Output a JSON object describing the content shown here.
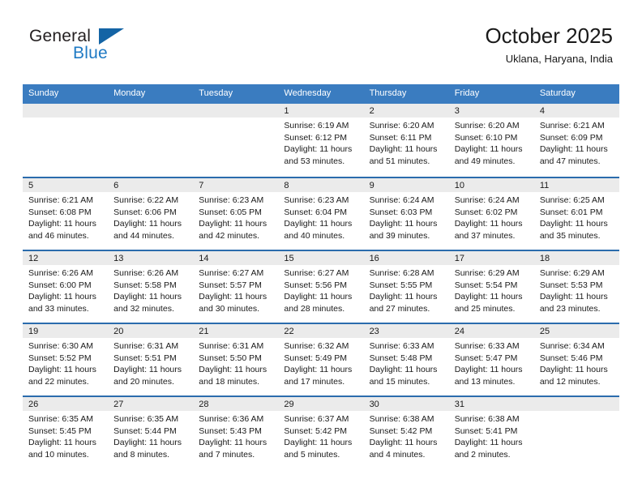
{
  "brand": {
    "name_top": "General",
    "name_bottom": "Blue",
    "triangle_icon": "triangle-icon",
    "accent_color": "#1f7ac4",
    "dark_color": "#231f20"
  },
  "header": {
    "title": "October 2025",
    "subtitle": "Uklana, Haryana, India"
  },
  "calendar": {
    "header_bg": "#3a7cc0",
    "row_divider": "#2b6cad",
    "day_band_bg": "#ebebeb",
    "weekdays": [
      "Sunday",
      "Monday",
      "Tuesday",
      "Wednesday",
      "Thursday",
      "Friday",
      "Saturday"
    ],
    "weeks": [
      [
        {
          "day": "",
          "sunrise": "",
          "sunset": "",
          "daylight_line1": "",
          "daylight_line2": ""
        },
        {
          "day": "",
          "sunrise": "",
          "sunset": "",
          "daylight_line1": "",
          "daylight_line2": ""
        },
        {
          "day": "",
          "sunrise": "",
          "sunset": "",
          "daylight_line1": "",
          "daylight_line2": ""
        },
        {
          "day": "1",
          "sunrise": "Sunrise: 6:19 AM",
          "sunset": "Sunset: 6:12 PM",
          "daylight_line1": "Daylight: 11 hours",
          "daylight_line2": "and 53 minutes."
        },
        {
          "day": "2",
          "sunrise": "Sunrise: 6:20 AM",
          "sunset": "Sunset: 6:11 PM",
          "daylight_line1": "Daylight: 11 hours",
          "daylight_line2": "and 51 minutes."
        },
        {
          "day": "3",
          "sunrise": "Sunrise: 6:20 AM",
          "sunset": "Sunset: 6:10 PM",
          "daylight_line1": "Daylight: 11 hours",
          "daylight_line2": "and 49 minutes."
        },
        {
          "day": "4",
          "sunrise": "Sunrise: 6:21 AM",
          "sunset": "Sunset: 6:09 PM",
          "daylight_line1": "Daylight: 11 hours",
          "daylight_line2": "and 47 minutes."
        }
      ],
      [
        {
          "day": "5",
          "sunrise": "Sunrise: 6:21 AM",
          "sunset": "Sunset: 6:08 PM",
          "daylight_line1": "Daylight: 11 hours",
          "daylight_line2": "and 46 minutes."
        },
        {
          "day": "6",
          "sunrise": "Sunrise: 6:22 AM",
          "sunset": "Sunset: 6:06 PM",
          "daylight_line1": "Daylight: 11 hours",
          "daylight_line2": "and 44 minutes."
        },
        {
          "day": "7",
          "sunrise": "Sunrise: 6:23 AM",
          "sunset": "Sunset: 6:05 PM",
          "daylight_line1": "Daylight: 11 hours",
          "daylight_line2": "and 42 minutes."
        },
        {
          "day": "8",
          "sunrise": "Sunrise: 6:23 AM",
          "sunset": "Sunset: 6:04 PM",
          "daylight_line1": "Daylight: 11 hours",
          "daylight_line2": "and 40 minutes."
        },
        {
          "day": "9",
          "sunrise": "Sunrise: 6:24 AM",
          "sunset": "Sunset: 6:03 PM",
          "daylight_line1": "Daylight: 11 hours",
          "daylight_line2": "and 39 minutes."
        },
        {
          "day": "10",
          "sunrise": "Sunrise: 6:24 AM",
          "sunset": "Sunset: 6:02 PM",
          "daylight_line1": "Daylight: 11 hours",
          "daylight_line2": "and 37 minutes."
        },
        {
          "day": "11",
          "sunrise": "Sunrise: 6:25 AM",
          "sunset": "Sunset: 6:01 PM",
          "daylight_line1": "Daylight: 11 hours",
          "daylight_line2": "and 35 minutes."
        }
      ],
      [
        {
          "day": "12",
          "sunrise": "Sunrise: 6:26 AM",
          "sunset": "Sunset: 6:00 PM",
          "daylight_line1": "Daylight: 11 hours",
          "daylight_line2": "and 33 minutes."
        },
        {
          "day": "13",
          "sunrise": "Sunrise: 6:26 AM",
          "sunset": "Sunset: 5:58 PM",
          "daylight_line1": "Daylight: 11 hours",
          "daylight_line2": "and 32 minutes."
        },
        {
          "day": "14",
          "sunrise": "Sunrise: 6:27 AM",
          "sunset": "Sunset: 5:57 PM",
          "daylight_line1": "Daylight: 11 hours",
          "daylight_line2": "and 30 minutes."
        },
        {
          "day": "15",
          "sunrise": "Sunrise: 6:27 AM",
          "sunset": "Sunset: 5:56 PM",
          "daylight_line1": "Daylight: 11 hours",
          "daylight_line2": "and 28 minutes."
        },
        {
          "day": "16",
          "sunrise": "Sunrise: 6:28 AM",
          "sunset": "Sunset: 5:55 PM",
          "daylight_line1": "Daylight: 11 hours",
          "daylight_line2": "and 27 minutes."
        },
        {
          "day": "17",
          "sunrise": "Sunrise: 6:29 AM",
          "sunset": "Sunset: 5:54 PM",
          "daylight_line1": "Daylight: 11 hours",
          "daylight_line2": "and 25 minutes."
        },
        {
          "day": "18",
          "sunrise": "Sunrise: 6:29 AM",
          "sunset": "Sunset: 5:53 PM",
          "daylight_line1": "Daylight: 11 hours",
          "daylight_line2": "and 23 minutes."
        }
      ],
      [
        {
          "day": "19",
          "sunrise": "Sunrise: 6:30 AM",
          "sunset": "Sunset: 5:52 PM",
          "daylight_line1": "Daylight: 11 hours",
          "daylight_line2": "and 22 minutes."
        },
        {
          "day": "20",
          "sunrise": "Sunrise: 6:31 AM",
          "sunset": "Sunset: 5:51 PM",
          "daylight_line1": "Daylight: 11 hours",
          "daylight_line2": "and 20 minutes."
        },
        {
          "day": "21",
          "sunrise": "Sunrise: 6:31 AM",
          "sunset": "Sunset: 5:50 PM",
          "daylight_line1": "Daylight: 11 hours",
          "daylight_line2": "and 18 minutes."
        },
        {
          "day": "22",
          "sunrise": "Sunrise: 6:32 AM",
          "sunset": "Sunset: 5:49 PM",
          "daylight_line1": "Daylight: 11 hours",
          "daylight_line2": "and 17 minutes."
        },
        {
          "day": "23",
          "sunrise": "Sunrise: 6:33 AM",
          "sunset": "Sunset: 5:48 PM",
          "daylight_line1": "Daylight: 11 hours",
          "daylight_line2": "and 15 minutes."
        },
        {
          "day": "24",
          "sunrise": "Sunrise: 6:33 AM",
          "sunset": "Sunset: 5:47 PM",
          "daylight_line1": "Daylight: 11 hours",
          "daylight_line2": "and 13 minutes."
        },
        {
          "day": "25",
          "sunrise": "Sunrise: 6:34 AM",
          "sunset": "Sunset: 5:46 PM",
          "daylight_line1": "Daylight: 11 hours",
          "daylight_line2": "and 12 minutes."
        }
      ],
      [
        {
          "day": "26",
          "sunrise": "Sunrise: 6:35 AM",
          "sunset": "Sunset: 5:45 PM",
          "daylight_line1": "Daylight: 11 hours",
          "daylight_line2": "and 10 minutes."
        },
        {
          "day": "27",
          "sunrise": "Sunrise: 6:35 AM",
          "sunset": "Sunset: 5:44 PM",
          "daylight_line1": "Daylight: 11 hours",
          "daylight_line2": "and 8 minutes."
        },
        {
          "day": "28",
          "sunrise": "Sunrise: 6:36 AM",
          "sunset": "Sunset: 5:43 PM",
          "daylight_line1": "Daylight: 11 hours",
          "daylight_line2": "and 7 minutes."
        },
        {
          "day": "29",
          "sunrise": "Sunrise: 6:37 AM",
          "sunset": "Sunset: 5:42 PM",
          "daylight_line1": "Daylight: 11 hours",
          "daylight_line2": "and 5 minutes."
        },
        {
          "day": "30",
          "sunrise": "Sunrise: 6:38 AM",
          "sunset": "Sunset: 5:42 PM",
          "daylight_line1": "Daylight: 11 hours",
          "daylight_line2": "and 4 minutes."
        },
        {
          "day": "31",
          "sunrise": "Sunrise: 6:38 AM",
          "sunset": "Sunset: 5:41 PM",
          "daylight_line1": "Daylight: 11 hours",
          "daylight_line2": "and 2 minutes."
        },
        {
          "day": "",
          "sunrise": "",
          "sunset": "",
          "daylight_line1": "",
          "daylight_line2": ""
        }
      ]
    ]
  }
}
